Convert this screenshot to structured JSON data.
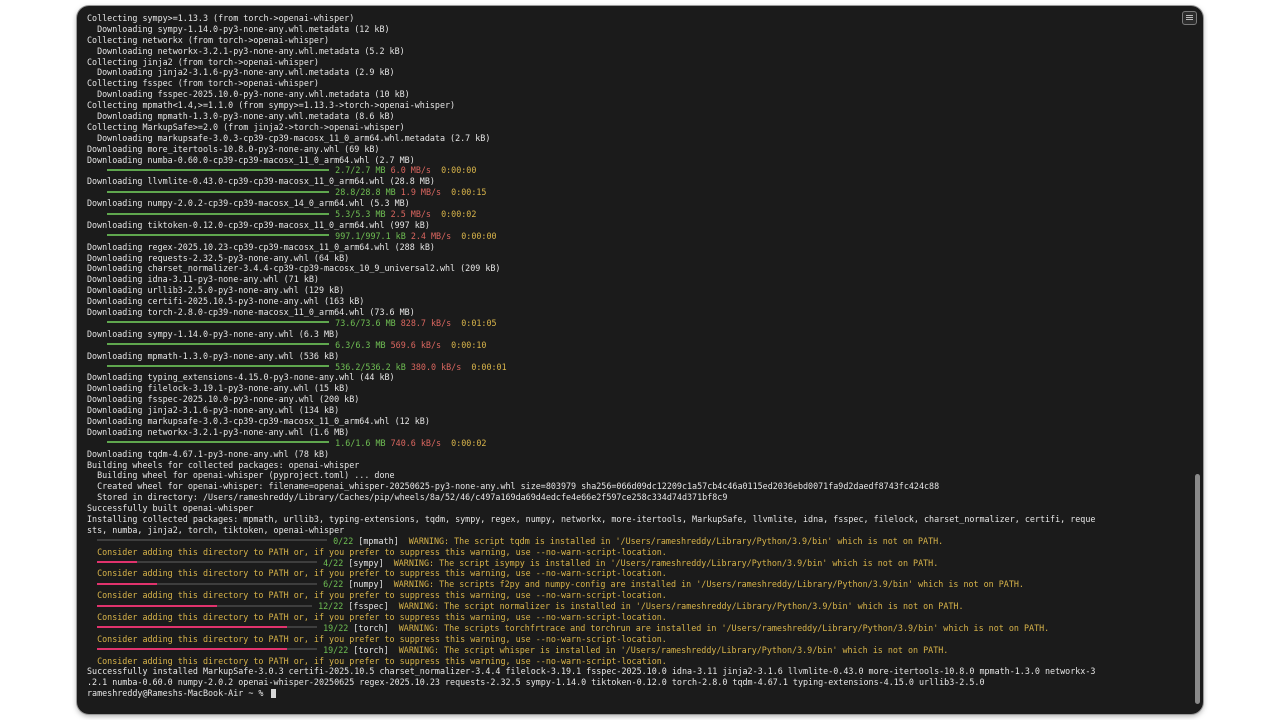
{
  "terminal": {
    "lines": [
      "Collecting sympy>=1.13.3 (from torch->openai-whisper)",
      "  Downloading sympy-1.14.0-py3-none-any.whl.metadata (12 kB)",
      "Collecting networkx (from torch->openai-whisper)",
      "  Downloading networkx-3.2.1-py3-none-any.whl.metadata (5.2 kB)",
      "Collecting jinja2 (from torch->openai-whisper)",
      "  Downloading jinja2-3.1.6-py3-none-any.whl.metadata (2.9 kB)",
      "Collecting fsspec (from torch->openai-whisper)",
      "  Downloading fsspec-2025.10.0-py3-none-any.whl.metadata (10 kB)",
      "Collecting mpmath<1.4,>=1.1.0 (from sympy>=1.13.3->torch->openai-whisper)",
      "  Downloading mpmath-1.3.0-py3-none-any.whl.metadata (8.6 kB)",
      "Collecting MarkupSafe>=2.0 (from jinja2->torch->openai-whisper)",
      "  Downloading markupsafe-3.0.3-cp39-cp39-macosx_11_0_arm64.whl.metadata (2.7 kB)",
      "Downloading more_itertools-10.8.0-py3-none-any.whl (69 kB)",
      "Downloading numba-0.60.0-cp39-cp39-macosx_11_0_arm64.whl (2.7 MB)",
      "Downloading llvmlite-0.43.0-cp39-cp39-macosx_11_0_arm64.whl (28.8 MB)",
      "Downloading numpy-2.0.2-cp39-cp39-macosx_14_0_arm64.whl (5.3 MB)",
      "Downloading tiktoken-0.12.0-cp39-cp39-macosx_11_0_arm64.whl (997 kB)",
      "Downloading regex-2025.10.23-cp39-cp39-macosx_11_0_arm64.whl (288 kB)",
      "Downloading requests-2.32.5-py3-none-any.whl (64 kB)",
      "Downloading charset_normalizer-3.4.4-cp39-cp39-macosx_10_9_universal2.whl (209 kB)",
      "Downloading idna-3.11-py3-none-any.whl (71 kB)",
      "Downloading urllib3-2.5.0-py3-none-any.whl (129 kB)",
      "Downloading certifi-2025.10.5-py3-none-any.whl (163 kB)",
      "Downloading torch-2.8.0-cp39-none-macosx_11_0_arm64.whl (73.6 MB)",
      "Downloading sympy-1.14.0-py3-none-any.whl (6.3 MB)",
      "Downloading mpmath-1.3.0-py3-none-any.whl (536 kB)",
      "Downloading typing_extensions-4.15.0-py3-none-any.whl (44 kB)",
      "Downloading filelock-3.19.1-py3-none-any.whl (15 kB)",
      "Downloading fsspec-2025.10.0-py3-none-any.whl (200 kB)",
      "Downloading jinja2-3.1.6-py3-none-any.whl (134 kB)",
      "Downloading markupsafe-3.0.3-cp39-cp39-macosx_11_0_arm64.whl (12 kB)",
      "Downloading networkx-3.2.1-py3-none-any.whl (1.6 MB)",
      "Downloading tqdm-4.67.1-py3-none-any.whl (78 kB)",
      "Building wheels for collected packages: openai-whisper",
      "  Building wheel for openai-whisper (pyproject.toml) ... done",
      "  Created wheel for openai-whisper: filename=openai_whisper-20250625-py3-none-any.whl size=803979 sha256=066d09dc12209c1a57cb4c46a0115ed2036ebd0071fa9d2daedf8743fc424c88",
      "  Stored in directory: /Users/rameshreddy/Library/Caches/pip/wheels/8a/52/46/c497a169da69d4edcfe4e66e2f597ce258c334d74d371bf8c9",
      "Successfully built openai-whisper",
      "Installing collected packages: mpmath, urllib3, typing-extensions, tqdm, sympy, regex, numpy, networkx, more-itertools, MarkupSafe, llvmlite, idna, fsspec, filelock, charset_normalizer, certifi, reque",
      "sts, numba, jinja2, torch, tiktoken, openai-whisper",
      "  Consider adding this directory to PATH or, if you prefer to suppress this warning, use --no-warn-script-location.",
      "Successfully installed MarkupSafe-3.0.3 certifi-2025.10.5 charset_normalizer-3.4.4 filelock-3.19.1 fsspec-2025.10.0 idna-3.11 jinja2-3.1.6 llvmlite-0.43.0 more-itertools-10.8.0 mpmath-1.3.0 networkx-3",
      ".2.1 numba-0.60.0 numpy-2.0.2 openai-whisper-20250625 regex-2025.10.23 requests-2.32.5 sympy-1.14.0 tiktoken-0.12.0 torch-2.8.0 tqdm-4.67.1 typing-extensions-4.15.0 urllib3-2.5.0"
    ],
    "downloads": [
      {
        "size": "2.7/2.7 MB",
        "speed": "6.0 MB/s",
        "eta": "0:00:00"
      },
      {
        "size": "28.8/28.8 MB",
        "speed": "1.9 MB/s",
        "eta": "0:00:15"
      },
      {
        "size": "5.3/5.3 MB",
        "speed": "2.5 MB/s",
        "eta": "0:00:02"
      },
      {
        "size": "997.1/997.1 kB",
        "speed": "2.4 MB/s",
        "eta": "0:00:00"
      },
      {
        "size": "73.6/73.6 MB",
        "speed": "828.7 kB/s",
        "eta": "0:01:05"
      },
      {
        "size": "6.3/6.3 MB",
        "speed": "569.6 kB/s",
        "eta": "0:00:10"
      },
      {
        "size": "536.2/536.2 kB",
        "speed": "380.0 kB/s",
        "eta": "0:00:01"
      },
      {
        "size": "1.6/1.6 MB",
        "speed": "740.6 kB/s",
        "eta": "0:00:02"
      }
    ],
    "install_progress": [
      {
        "count": "0/22",
        "pkg": "[mpmath]",
        "warning": "WARNING: The script tqdm is installed in '/Users/rameshreddy/Library/Python/3.9/bin' which is not on PATH.",
        "fraction": 0.0
      },
      {
        "count": "4/22",
        "pkg": "[sympy]",
        "warning": "WARNING: The script isympy is installed in '/Users/rameshreddy/Library/Python/3.9/bin' which is not on PATH.",
        "fraction": 0.18
      },
      {
        "count": "6/22",
        "pkg": "[numpy]",
        "warning": "WARNING: The scripts f2py and numpy-config are installed in '/Users/rameshreddy/Library/Python/3.9/bin' which is not on PATH.",
        "fraction": 0.27
      },
      {
        "count": "12/22",
        "pkg": "[fsspec]",
        "warning": "WARNING: The script normalizer is installed in '/Users/rameshreddy/Library/Python/3.9/bin' which is not on PATH.",
        "fraction": 0.55
      },
      {
        "count": "19/22",
        "pkg": "[torch]",
        "warning": "WARNING: The scripts torchfrtrace and torchrun are installed in '/Users/rameshreddy/Library/Python/3.9/bin' which is not on PATH.",
        "fraction": 0.86
      },
      {
        "count": "19/22",
        "pkg": "[torch]",
        "warning": "WARNING: The script whisper is installed in '/Users/rameshreddy/Library/Python/3.9/bin' which is not on PATH.",
        "fraction": 0.86
      }
    ],
    "prompt": "rameshreddy@Rameshs-MacBook-Air ~ %",
    "colors": {
      "background": "#1b1b1b",
      "text": "#e6e6e6",
      "green": "#6fbf53",
      "red": "#d9665f",
      "yellow": "#d8b44a",
      "pink": "#e0336d"
    }
  }
}
